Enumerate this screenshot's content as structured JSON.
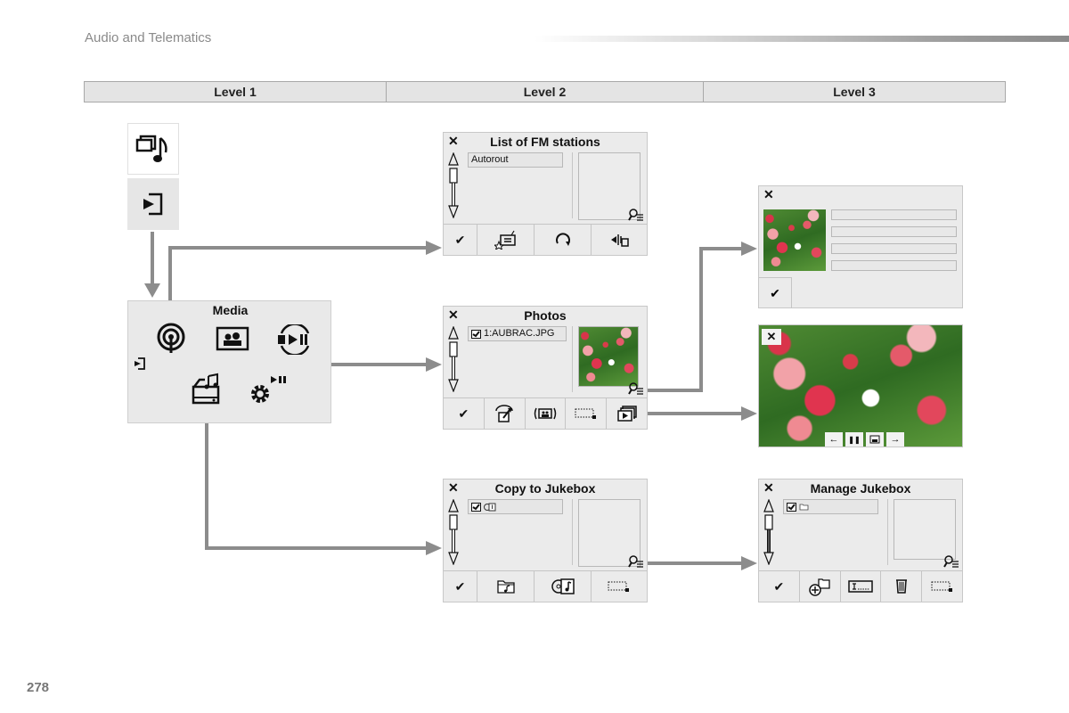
{
  "header": {
    "section_title": "Audio and Telematics",
    "page_number": "278"
  },
  "levels": [
    "Level 1",
    "Level 2",
    "Level 3"
  ],
  "level1": {
    "media_mode_icon": "media-mode-icon",
    "source_icon": "source-input-icon",
    "media_panel": {
      "title": "Media",
      "icons": [
        "radio-antenna-icon",
        "photos-icon",
        "media-player-icon",
        "source-input-icon",
        "jukebox-drive-icon",
        "settings-play-icon"
      ]
    }
  },
  "screens": {
    "fm_stations": {
      "title": "List of FM stations",
      "list_item": "Autorout",
      "toolbar": [
        "confirm-check-icon",
        "favorite-radio-icon",
        "refresh-icon",
        "audio-settings-icon"
      ],
      "check": "✔"
    },
    "photos": {
      "title": "Photos",
      "list_item": "1:AUBRAC.JPG",
      "toolbar": [
        "confirm-check-icon",
        "rotate-photo-icon",
        "photo-display-icon",
        "select-area-icon",
        "slideshow-icon"
      ],
      "check": "✔"
    },
    "copy_jukebox": {
      "title": "Copy to Jukebox",
      "toolbar": [
        "confirm-check-icon",
        "music-folder-icon",
        "cd-to-music-icon",
        "select-area-icon"
      ],
      "check": "✔"
    },
    "photo_info": {
      "fields": [
        "",
        "",
        "",
        ""
      ],
      "check": "✔"
    },
    "slideshow": {
      "controls": [
        "previous-arrow-icon",
        "pause-icon",
        "photo-display-icon",
        "next-arrow-icon"
      ],
      "control_glyphs": [
        "←",
        "❚❚",
        "",
        "→"
      ]
    },
    "manage_jukebox": {
      "title": "Manage Jukebox",
      "toolbar": [
        "confirm-check-icon",
        "add-folder-icon",
        "rename-icon",
        "delete-trash-icon",
        "select-area-icon"
      ],
      "check": "✔"
    }
  },
  "symbols": {
    "close": "✕",
    "up": "△",
    "down": "▽"
  },
  "colors": {
    "arrow": "#8c8c8c",
    "panel_bg": "#ebebeb",
    "border": "#c8c8c8",
    "header_text": "#8a8a8a"
  }
}
